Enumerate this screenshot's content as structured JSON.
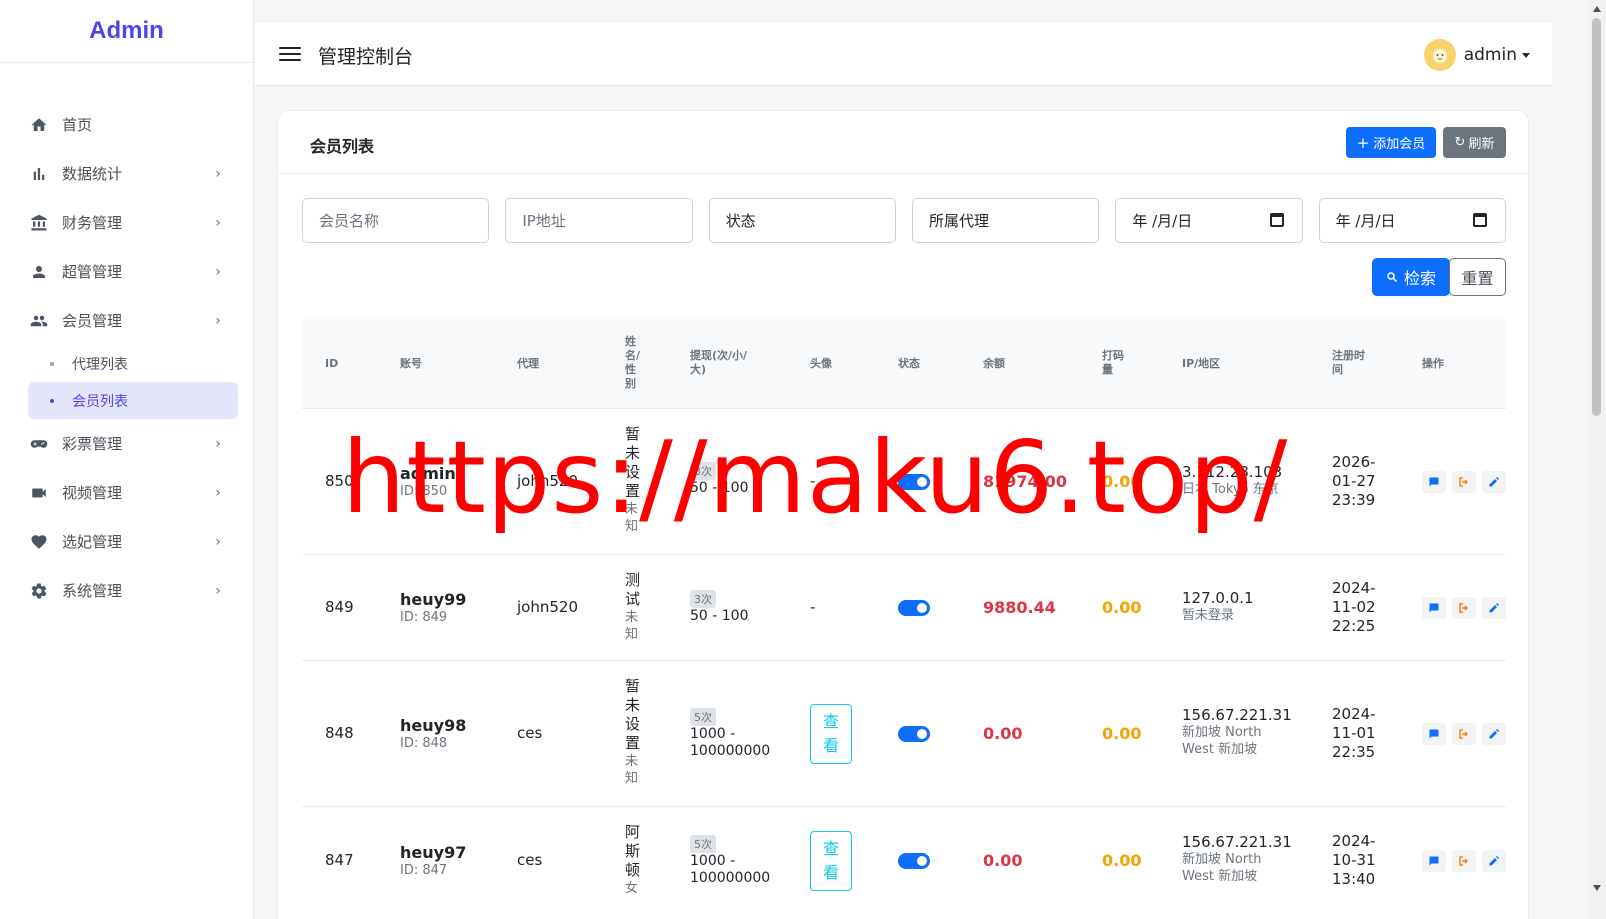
{
  "sidebar": {
    "brand": "Admin",
    "items": [
      {
        "label": "首页",
        "icon": "home-icon"
      },
      {
        "label": "数据统计",
        "icon": "bar-chart-icon"
      },
      {
        "label": "财务管理",
        "icon": "bank-icon"
      },
      {
        "label": "超管管理",
        "icon": "user-icon"
      },
      {
        "label": "会员管理",
        "icon": "users-icon"
      },
      {
        "label": "彩票管理",
        "icon": "gamepad-icon"
      },
      {
        "label": "视频管理",
        "icon": "video-icon"
      },
      {
        "label": "选妃管理",
        "icon": "heart-icon"
      },
      {
        "label": "系统管理",
        "icon": "gear-icon"
      }
    ],
    "sub_items": [
      {
        "label": "代理列表"
      },
      {
        "label": "会员列表"
      }
    ]
  },
  "header": {
    "title": "管理控制台",
    "username": "admin"
  },
  "card": {
    "title": "会员列表",
    "add_label": "添加会员",
    "refresh_label": "刷新"
  },
  "filters": {
    "member_name": "会员名称",
    "ip": "IP地址",
    "status": "状态",
    "agent": "所属代理",
    "date_from": "年 /月/日",
    "date_to": "年 /月/日",
    "search_label": "检索",
    "reset_label": "重置"
  },
  "table": {
    "headers": {
      "id": "ID",
      "account": "账号",
      "agent": "代理",
      "name_gender": "姓名/性别",
      "withdraw": "提现(次/小/大)",
      "avatar": "头像",
      "status": "状态",
      "balance": "余额",
      "bet": "打码量",
      "ip_region": "IP/地区",
      "reg_time": "注册时间",
      "ops": "操作"
    },
    "rows": [
      {
        "id": "850",
        "account": "admin",
        "account_id": "ID: 850",
        "agent": "john520",
        "name": "暂未设置",
        "gender": "未知",
        "withdraw_count": "3次",
        "withdraw_range": "50 - 100",
        "avatar": "-",
        "status_on": true,
        "balance": "81974.00",
        "bet": "0.00",
        "ip": "3.112.28.103",
        "region": "日本 Tokyo 东京",
        "reg_date": "2026-01-27",
        "reg_time": "23:39"
      },
      {
        "id": "849",
        "account": "heuy99",
        "account_id": "ID: 849",
        "agent": "john520",
        "name": "测试",
        "gender": "未知",
        "withdraw_count": "3次",
        "withdraw_range": "50 - 100",
        "avatar": "-",
        "status_on": true,
        "balance": "9880.44",
        "bet": "0.00",
        "ip": "127.0.0.1",
        "region": "暂未登录",
        "reg_date": "2024-11-02",
        "reg_time": "22:25"
      },
      {
        "id": "848",
        "account": "heuy98",
        "account_id": "ID: 848",
        "agent": "ces",
        "name": "暂未设置",
        "gender": "未知",
        "withdraw_count": "5次",
        "withdraw_range": "1000 - 100000000",
        "avatar": "查看",
        "status_on": true,
        "balance": "0.00",
        "bet": "0.00",
        "ip": "156.67.221.31",
        "region": "新加坡 North West 新加坡",
        "reg_date": "2024-11-01",
        "reg_time": "22:35"
      },
      {
        "id": "847",
        "account": "heuy97",
        "account_id": "ID: 847",
        "agent": "ces",
        "name": "阿斯顿",
        "gender": "女",
        "withdraw_count": "5次",
        "withdraw_range": "1000 - 100000000",
        "avatar": "查看",
        "status_on": true,
        "balance": "0.00",
        "bet": "0.00",
        "ip": "156.67.221.31",
        "region": "新加坡 North West 新加坡",
        "reg_date": "2024-10-31",
        "reg_time": "13:40"
      }
    ]
  },
  "watermark": "https://maku6.top/",
  "colors": {
    "primary": "#0d6efd",
    "brand": "#4f46e5",
    "danger": "#dc3545",
    "warning": "#f0a500"
  }
}
